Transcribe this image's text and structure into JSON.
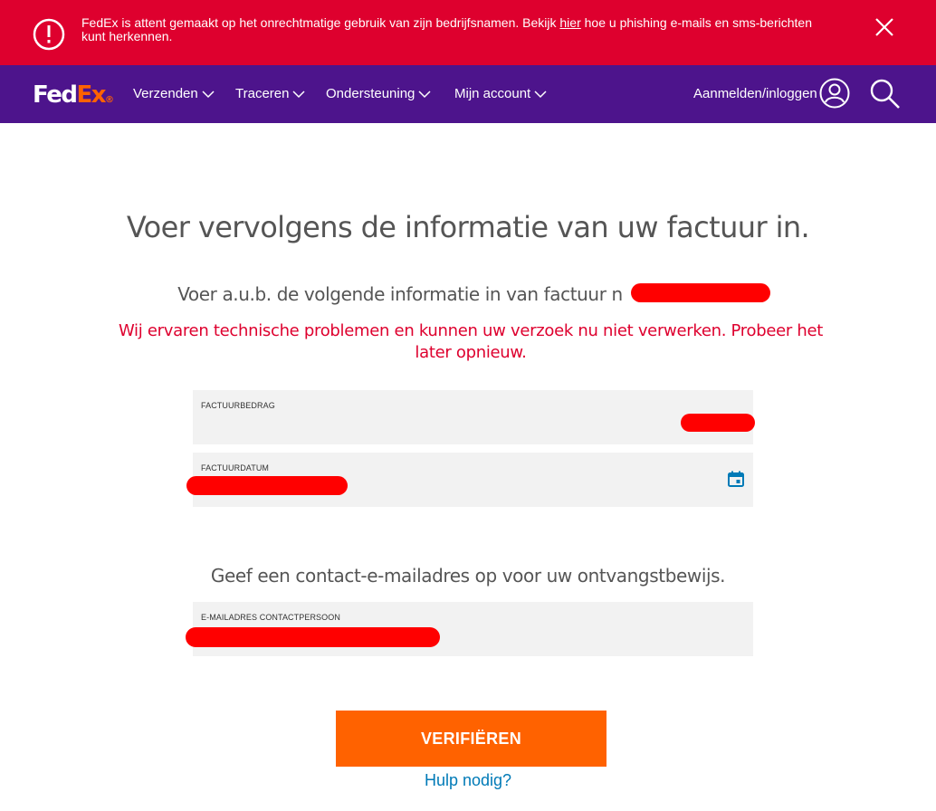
{
  "alert": {
    "text_before": "FedEx is attent gemaakt op het onrechtmatige gebruik van zijn bedrijfsnamen. Bekijk ",
    "link_text": "hier",
    "text_after": " hoe u phishing e-mails en sms-berichten kunt herkennen.",
    "icon": "alert-circle-icon",
    "close_icon": "close-icon",
    "background": "#de002e"
  },
  "nav": {
    "logo": {
      "part1": "Fed",
      "part2": "Ex",
      "mark": "®"
    },
    "items": [
      {
        "label": "Verzenden"
      },
      {
        "label": "Traceren"
      },
      {
        "label": "Ondersteuning"
      },
      {
        "label": "Mijn account"
      }
    ],
    "login_label": "Aanmelden/inloggen",
    "user_icon": "user-icon",
    "search_icon": "search-icon",
    "background": "#4d148c"
  },
  "main": {
    "heading": "Voer vervolgens de informatie van uw factuur in.",
    "subheading": "Voer a.u.b. de volgende informatie in van factuur n",
    "error": "Wij ervaren technische problemen en kunnen uw verzoek nu niet verwerken. Probeer het later opnieuw.",
    "fields": {
      "amount": {
        "label": "FACTUURBEDRAG",
        "value": ""
      },
      "date": {
        "label": "FACTUURDATUM",
        "value": "",
        "icon": "calendar-icon"
      }
    },
    "contact_heading": "Geef een contact-e-mailadres op voor uw ontvangstbewijs.",
    "email": {
      "label": "E-MAILADRES CONTACTPERSOON",
      "value": ""
    },
    "verify_label": "VERIFIËREN",
    "help_link": "Hulp nodig?",
    "accent": "#ff6200",
    "error_color": "#de002e",
    "link_color": "#007ab7"
  }
}
